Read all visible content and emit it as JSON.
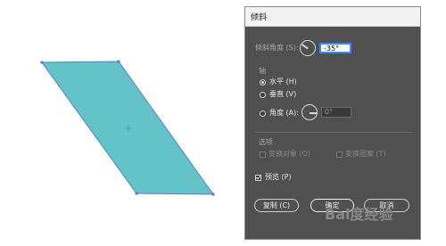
{
  "dialog": {
    "title": "倾斜",
    "shear_angle_label": "倾斜角度 (S):",
    "shear_angle_value": "-35°",
    "axis_label": "轴",
    "axis_options": [
      {
        "label": "水平 (H)",
        "checked": true
      },
      {
        "label": "垂直 (V)",
        "checked": false
      },
      {
        "label": "角度 (A):",
        "checked": false
      }
    ],
    "axis_angle_value": "0°",
    "options_label": "选项",
    "transform_objects": "变换对象 (O)",
    "transform_patterns": "变换图案 (T)",
    "preview_label": "预览 (P)",
    "preview_checked": true,
    "buttons": {
      "copy": "复制 (C)",
      "ok": "确定",
      "cancel": "取消"
    }
  },
  "canvas": {
    "shape_fill": "#63c3c7",
    "shape_stroke": "#4e7fd1"
  },
  "watermark": "Bai度经验",
  "colors": {
    "dialog_bg": "#505050",
    "accent": "#2d8cff"
  }
}
